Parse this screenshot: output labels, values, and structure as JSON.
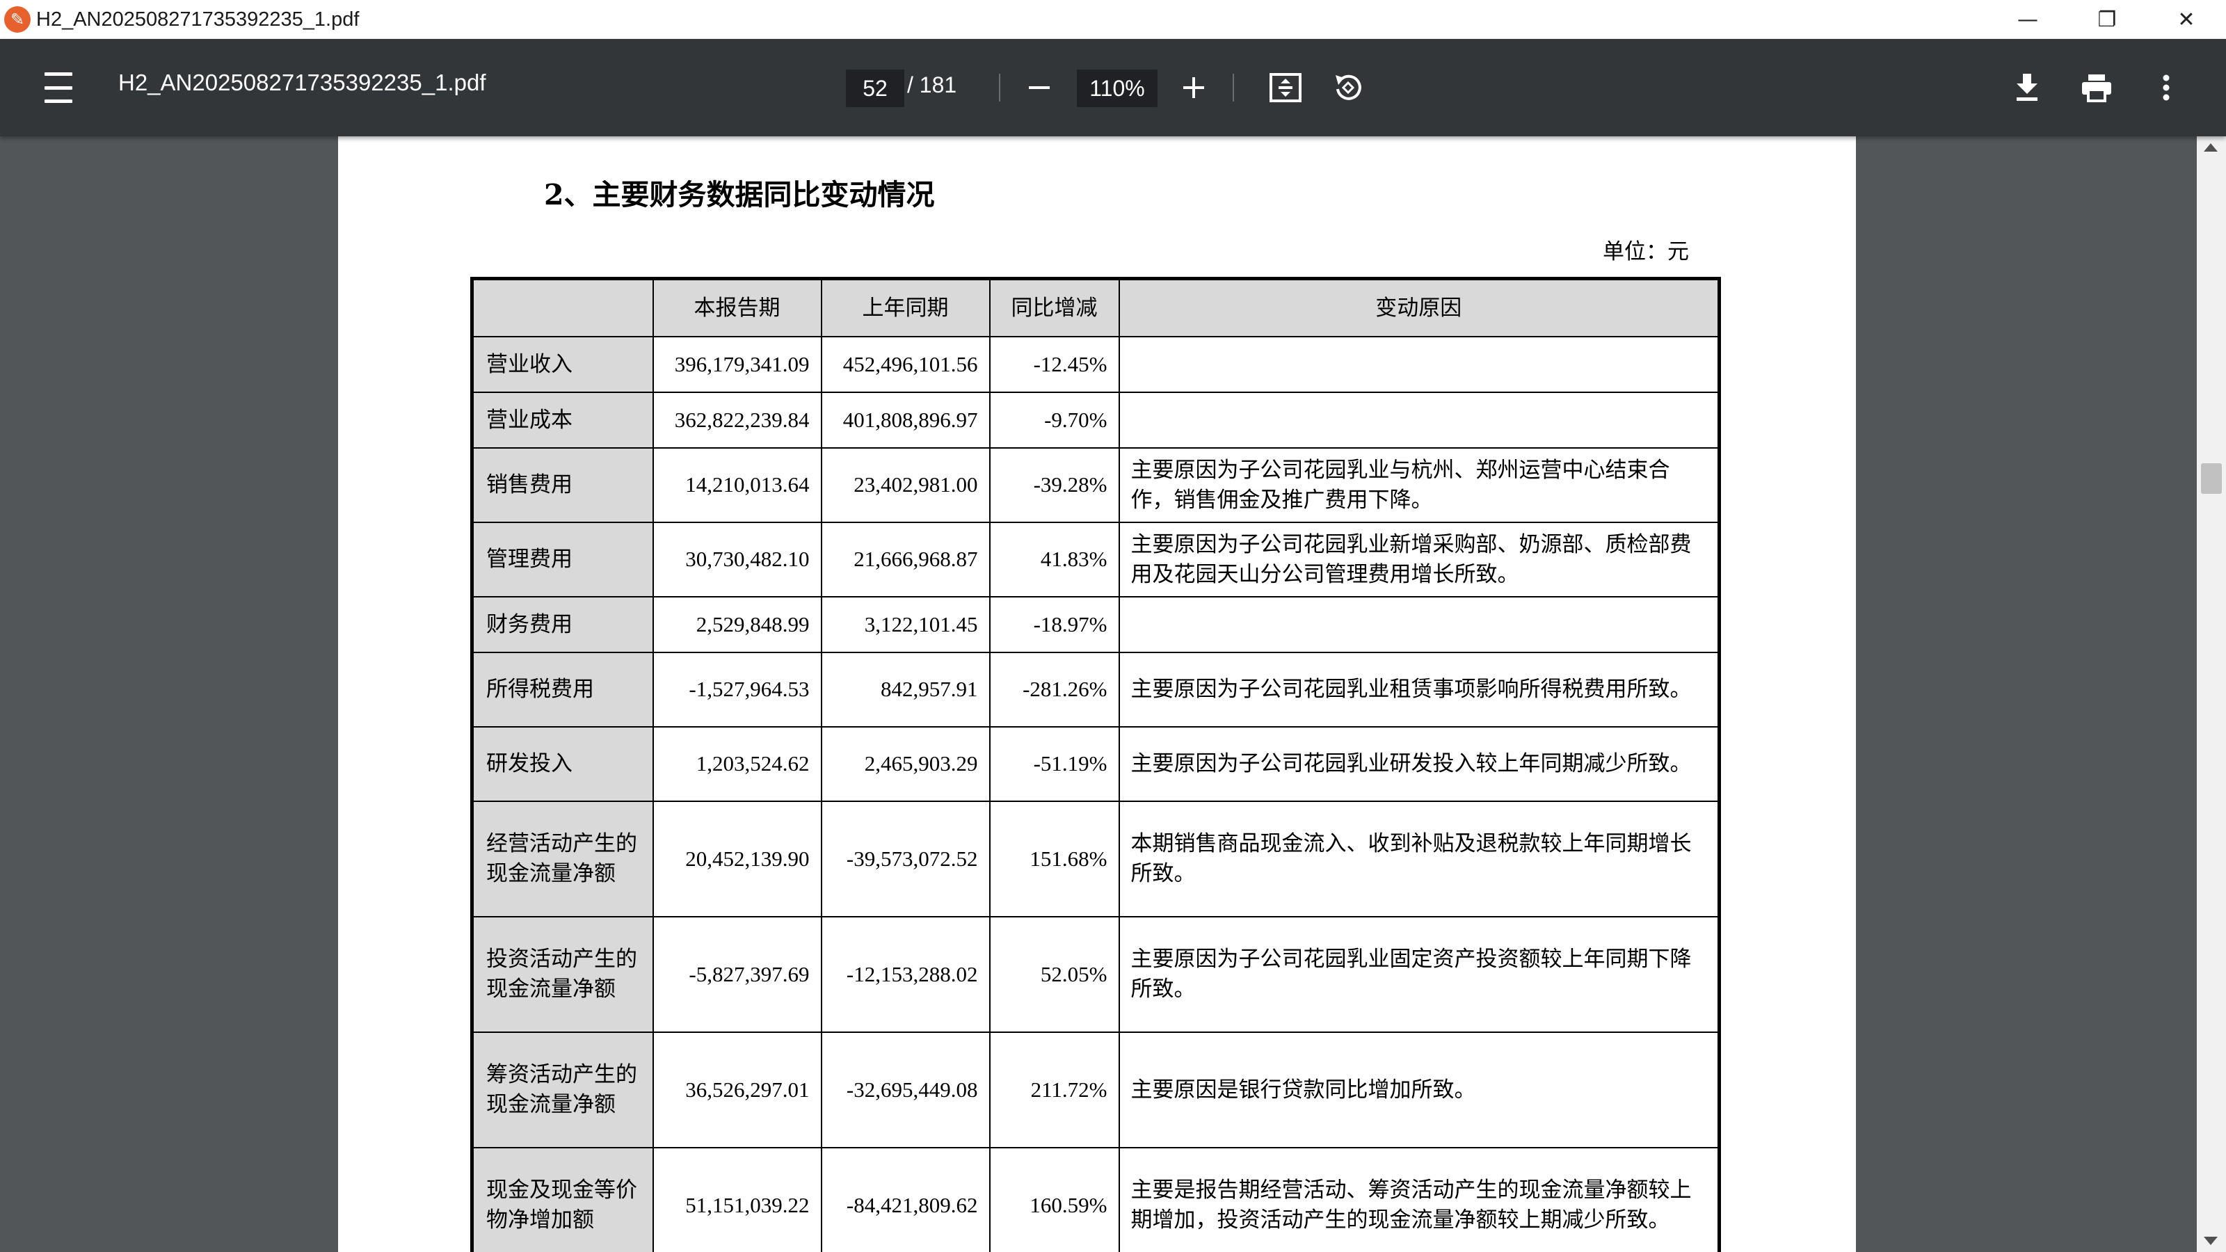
{
  "window": {
    "title": "H2_AN202508271735392235_1.pdf",
    "minimize": "—",
    "restore": "❐",
    "close": "✕"
  },
  "toolbar": {
    "doc_title": "H2_AN202508271735392235_1.pdf",
    "page_current": "52",
    "page_total": "/ 181",
    "zoom": "110%"
  },
  "icons": {
    "menu": "menu-icon",
    "zoom_out": "minus-icon",
    "zoom_in": "plus-icon",
    "fit": "fit-page-icon",
    "rotate": "rotate-icon",
    "download": "download-icon",
    "print": "print-icon",
    "more": "more-vertical-icon"
  },
  "document": {
    "section_title": "2、主要财务数据同比变动情况",
    "unit": "单位：元",
    "table": {
      "headers": [
        "",
        "本报告期",
        "上年同期",
        "同比增减",
        "变动原因"
      ],
      "rows": [
        {
          "label": "营业收入",
          "current": "396,179,341.09",
          "prior": "452,496,101.56",
          "change": "-12.45%",
          "reason": "",
          "h": 1
        },
        {
          "label": "营业成本",
          "current": "362,822,239.84",
          "prior": "401,808,896.97",
          "change": "-9.70%",
          "reason": "",
          "h": 1
        },
        {
          "label": "销售费用",
          "current": "14,210,013.64",
          "prior": "23,402,981.00",
          "change": "-39.28%",
          "reason": "主要原因为子公司花园乳业与杭州、郑州运营中心结束合作，销售佣金及推广费用下降。",
          "h": 2
        },
        {
          "label": "管理费用",
          "current": "30,730,482.10",
          "prior": "21,666,968.87",
          "change": "41.83%",
          "reason": "主要原因为子公司花园乳业新增采购部、奶源部、质检部费用及花园天山分公司管理费用增长所致。",
          "h": 2
        },
        {
          "label": "财务费用",
          "current": "2,529,848.99",
          "prior": "3,122,101.45",
          "change": "-18.97%",
          "reason": "",
          "h": 1
        },
        {
          "label": "所得税费用",
          "current": "-1,527,964.53",
          "prior": "842,957.91",
          "change": "-281.26%",
          "reason": "主要原因为子公司花园乳业租赁事项影响所得税费用所致。",
          "h": 2
        },
        {
          "label": "研发投入",
          "current": "1,203,524.62",
          "prior": "2,465,903.29",
          "change": "-51.19%",
          "reason": "主要原因为子公司花园乳业研发投入较上年同期减少所致。",
          "h": 2
        },
        {
          "label": "经营活动产生的现金流量净额",
          "current": "20,452,139.90",
          "prior": "-39,573,072.52",
          "change": "151.68%",
          "reason": "本期销售商品现金流入、收到补贴及退税款较上年同期增长所致。",
          "h": 3
        },
        {
          "label": "投资活动产生的现金流量净额",
          "current": "-5,827,397.69",
          "prior": "-12,153,288.02",
          "change": "52.05%",
          "reason": "主要原因为子公司花园乳业固定资产投资额较上年同期下降所致。",
          "h": 3
        },
        {
          "label": "筹资活动产生的现金流量净额",
          "current": "36,526,297.01",
          "prior": "-32,695,449.08",
          "change": "211.72%",
          "reason": "主要原因是银行贷款同比增加所致。",
          "h": 3
        },
        {
          "label": "现金及现金等价物净增加额",
          "current": "51,151,039.22",
          "prior": "-84,421,809.62",
          "change": "160.59%",
          "reason": "主要是报告期经营活动、筹资活动产生的现金流量净额较上期增加，投资活动产生的现金流量净额较上期减少所致。",
          "h": 3
        }
      ]
    }
  },
  "colors": {
    "toolbar_bg": "#323639",
    "viewer_bg": "#525659",
    "header_fill": "#d9d9d9",
    "app_icon": "#e8602c"
  }
}
